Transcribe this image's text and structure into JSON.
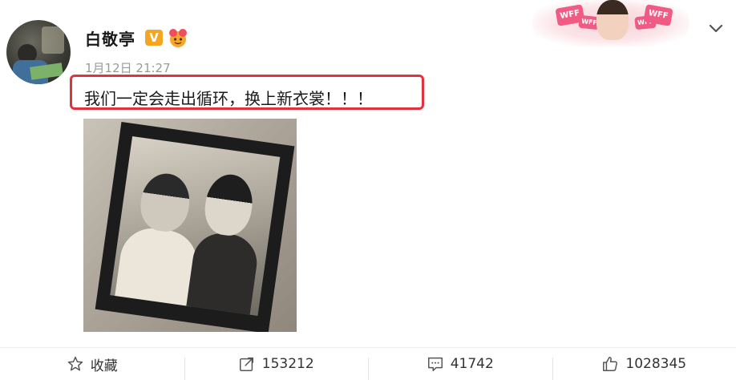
{
  "user": {
    "name": "白敬亭",
    "verified_badge": "V",
    "timestamp": "1月12日 21:27"
  },
  "decoration": {
    "sticker_text": "WFF"
  },
  "post": {
    "text": "我们一定会走出循环，换上新衣裳！！！",
    "highlight_color": "#e2333c"
  },
  "actions": {
    "favorite_label": "收藏",
    "repost_count": "153212",
    "comment_count": "41742",
    "like_count": "1028345"
  },
  "icons": {
    "favorite": "star-outline-icon",
    "repost": "share-arrow-icon",
    "comment": "comment-bubble-icon",
    "like": "thumbs-up-icon",
    "menu": "chevron-down-icon"
  }
}
